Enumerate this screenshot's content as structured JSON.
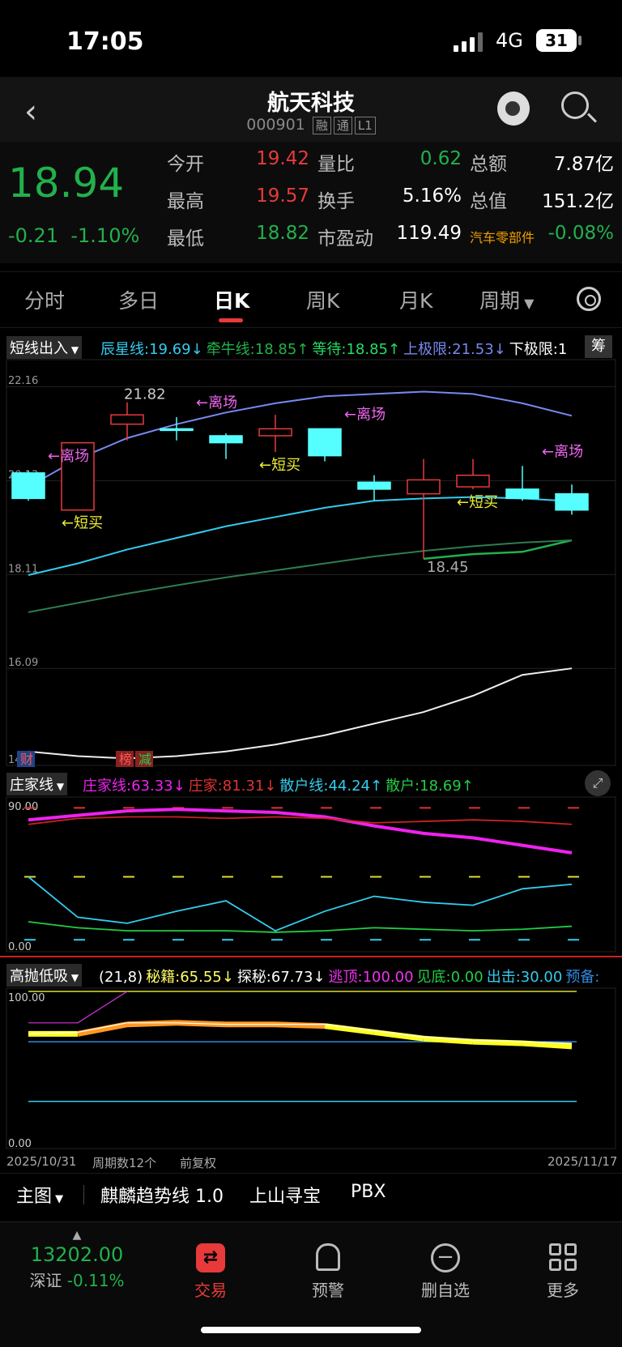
{
  "status": {
    "time": "17:05",
    "network": "4G",
    "battery": "31"
  },
  "header": {
    "title": "航天科技",
    "code": "000901",
    "tags": [
      "融",
      "通",
      "L1"
    ]
  },
  "quote": {
    "price": "18.94",
    "change": "-0.21",
    "change_pct": "-1.10%",
    "fields": [
      {
        "label": "今开",
        "value": "19.42",
        "color": "red"
      },
      {
        "label": "量比",
        "value": "0.62",
        "color": "green"
      },
      {
        "label": "总额",
        "value": "7.87亿",
        "color": "white"
      },
      {
        "label": "最高",
        "value": "19.57",
        "color": "red"
      },
      {
        "label": "换手",
        "value": "5.16%",
        "color": "white"
      },
      {
        "label": "总值",
        "value": "151.2亿",
        "color": "white"
      },
      {
        "label": "最低",
        "value": "18.82",
        "color": "green"
      },
      {
        "label": "市盈动",
        "value": "119.49",
        "color": "white"
      },
      {
        "label": "汽车零部件",
        "value": "-0.08%",
        "color": "green"
      }
    ]
  },
  "tabs": [
    "分时",
    "多日",
    "日K",
    "周K",
    "月K",
    "周期"
  ],
  "main_indicator": {
    "selector": "短线出入",
    "items": [
      {
        "text": "辰星线:19.69↓",
        "color": "#33ccee"
      },
      {
        "text": "牵牛线:18.85↑",
        "color": "#22b14c"
      },
      {
        "text": "等待:18.85↑",
        "color": "#22dd66"
      },
      {
        "text": "上极限:21.53↓",
        "color": "#7788ee"
      },
      {
        "text": "下极限:1",
        "color": "#ffffff"
      }
    ],
    "right_badge": "筹"
  },
  "chart_data": [
    {
      "type": "candlestick",
      "title": "日K",
      "y_ticks": [
        "22.16",
        "20.13",
        "18.11",
        "16.09",
        "14"
      ],
      "y_range": [
        14.0,
        22.6
      ],
      "candles": [
        {
          "open": 19.75,
          "close": 20.3,
          "high": 20.35,
          "low": 19.7,
          "dir": "up"
        },
        {
          "open": 19.5,
          "close": 20.95,
          "high": 20.95,
          "low": 19.5,
          "dir": "down"
        },
        {
          "open": 21.35,
          "close": 21.55,
          "high": 21.82,
          "low": 21.0,
          "dir": "down"
        },
        {
          "open": 21.25,
          "close": 21.25,
          "high": 21.5,
          "low": 21.0,
          "dir": "up"
        },
        {
          "open": 20.95,
          "close": 21.1,
          "high": 21.15,
          "low": 20.6,
          "dir": "up"
        },
        {
          "open": 21.1,
          "close": 21.25,
          "high": 21.55,
          "low": 20.75,
          "dir": "down"
        },
        {
          "open": 20.67,
          "close": 21.25,
          "high": 21.25,
          "low": 20.55,
          "dir": "up"
        },
        {
          "open": 19.95,
          "close": 20.1,
          "high": 20.25,
          "low": 19.7,
          "dir": "up"
        },
        {
          "open": 19.85,
          "close": 20.15,
          "high": 20.6,
          "low": 18.45,
          "dir": "down"
        },
        {
          "open": 20.0,
          "close": 20.25,
          "high": 20.6,
          "low": 19.95,
          "dir": "down"
        },
        {
          "open": 19.75,
          "close": 19.95,
          "high": 20.45,
          "low": 19.7,
          "dir": "up"
        },
        {
          "open": 19.5,
          "close": 19.85,
          "high": 20.05,
          "low": 19.4,
          "dir": "up"
        }
      ],
      "annotations": [
        {
          "text": "←离场",
          "candle": 0,
          "color": "#ee66ee"
        },
        {
          "text": "←短买",
          "candle": 1,
          "color": "#eeee33"
        },
        {
          "text": "21.82",
          "candle": 2,
          "color": "#cccccc"
        },
        {
          "text": "←离场",
          "candle": 3,
          "color": "#ee66ee"
        },
        {
          "text": "←短买",
          "candle": 5,
          "color": "#eeee33"
        },
        {
          "text": "←离场",
          "candle": 6,
          "color": "#ee66ee"
        },
        {
          "text": "18.45",
          "candle": 8,
          "color": "#aaaaaa"
        },
        {
          "text": "←短买",
          "candle": 9,
          "color": "#eeee33"
        },
        {
          "text": "←离场",
          "candle": 10,
          "color": "#ee66ee"
        }
      ],
      "series": [
        {
          "name": "上极限",
          "color": "#7788ee",
          "values": [
            20.0,
            20.6,
            21.05,
            21.35,
            21.6,
            21.8,
            21.95,
            22.0,
            22.05,
            22.0,
            21.8,
            21.53
          ]
        },
        {
          "name": "辰星线",
          "color": "#33ccee",
          "values": [
            18.1,
            18.35,
            18.65,
            18.9,
            19.15,
            19.35,
            19.55,
            19.7,
            19.75,
            19.78,
            19.75,
            19.69
          ]
        },
        {
          "name": "牵牛线",
          "color": "#22b14c",
          "values": [
            null,
            null,
            null,
            null,
            null,
            null,
            null,
            null,
            18.45,
            18.55,
            18.6,
            18.85
          ]
        },
        {
          "name": "下轨线",
          "color": "#2e7d50",
          "values": [
            17.3,
            17.5,
            17.7,
            17.88,
            18.05,
            18.2,
            18.35,
            18.5,
            18.62,
            18.72,
            18.8,
            18.85
          ]
        },
        {
          "name": "长期线",
          "color": "#eeeeee",
          "values": [
            14.3,
            14.2,
            14.15,
            14.2,
            14.3,
            14.45,
            14.65,
            14.9,
            15.15,
            15.5,
            15.95,
            16.09
          ]
        }
      ],
      "bottom_labels": [
        {
          "text": "财",
          "candle": 0
        },
        {
          "text": "榜",
          "candle": 2
        },
        {
          "text": "减",
          "candle": 2
        }
      ]
    },
    {
      "type": "line",
      "title": "庄家线",
      "y_ticks": [
        "90.00",
        "0.00"
      ],
      "y_range": [
        0,
        100
      ],
      "series": [
        {
          "name": "庄家线",
          "color": "#ee22ee",
          "values": [
            88,
            91,
            94,
            95,
            94,
            93,
            90,
            84,
            79,
            76,
            71,
            66
          ]
        },
        {
          "name": "庄家",
          "color": "#cc2222",
          "values": [
            85,
            89,
            90,
            90,
            89,
            90,
            89,
            86,
            87,
            88,
            87,
            85
          ]
        },
        {
          "name": "散户线",
          "color": "#33ccee",
          "values": [
            50,
            23,
            19,
            27,
            34,
            14,
            27,
            37,
            33,
            31,
            42,
            45
          ]
        },
        {
          "name": "散户",
          "color": "#22cc44",
          "values": [
            20,
            16,
            14,
            14,
            14,
            13,
            14,
            16,
            15,
            14,
            15,
            17
          ]
        }
      ],
      "dashes": [
        {
          "level": 96,
          "color": "#dd3333"
        },
        {
          "level": 50,
          "color": "#dddd33"
        },
        {
          "level": 8,
          "color": "#33ccee"
        }
      ]
    },
    {
      "type": "line",
      "title": "高抛低吸",
      "y_ticks": [
        "100.00",
        "0.00"
      ],
      "y_range": [
        0,
        100
      ],
      "series": [
        {
          "name": "秘籍",
          "color": "#ffff33",
          "values": [
            73,
            73,
            79,
            80,
            79,
            79,
            78,
            74,
            70,
            68,
            67,
            65
          ]
        },
        {
          "name": "探秘",
          "color": "#ffffff",
          "values": [
            73,
            74,
            80,
            80,
            79,
            79,
            79,
            75,
            71,
            69,
            68,
            67
          ]
        },
        {
          "name": "逃顶",
          "color": "#dd33dd",
          "values": [
            80,
            80,
            100,
            null,
            null,
            null,
            null,
            null,
            null,
            null,
            null,
            null
          ]
        }
      ],
      "hlines": [
        {
          "level": 100,
          "color": "#dddd33"
        },
        {
          "level": 68,
          "color": "#3388dd"
        },
        {
          "level": 30,
          "color": "#33ccee"
        }
      ]
    }
  ],
  "sub1_indicator": {
    "selector": "庄家线",
    "items": [
      {
        "text": "庄家线:63.33↓",
        "color": "#ee22ee"
      },
      {
        "text": "庄家:81.31↓",
        "color": "#dd3333"
      },
      {
        "text": "散户线:44.24↑",
        "color": "#33ccee"
      },
      {
        "text": "散户:18.69↑",
        "color": "#22cc44"
      }
    ]
  },
  "sub2_indicator": {
    "selector": "高抛低吸",
    "items": [
      {
        "text": "(21,8)",
        "color": "#ffffff"
      },
      {
        "text": "秘籍:65.55↓",
        "color": "#ffff66"
      },
      {
        "text": "探秘:67.73↓",
        "color": "#ffffff"
      },
      {
        "text": "逃顶:100.00",
        "color": "#ee33ee"
      },
      {
        "text": "见底:0.00",
        "color": "#22cc44"
      },
      {
        "text": "出击:30.00",
        "color": "#33ccee"
      },
      {
        "text": "预备:",
        "color": "#3388dd"
      }
    ]
  },
  "date_axis": {
    "start": "2025/10/31",
    "period": "周期数12个",
    "adjust": "前复权",
    "end": "2025/11/17"
  },
  "bottom_tabs": [
    "主图",
    "麒麟趋势线 1.0",
    "上山寻宝",
    "PBX"
  ],
  "footer": {
    "index_value": "13202.00",
    "index_name": "深证",
    "index_change": "-0.11%",
    "items": [
      "交易",
      "预警",
      "删自选",
      "更多"
    ]
  }
}
